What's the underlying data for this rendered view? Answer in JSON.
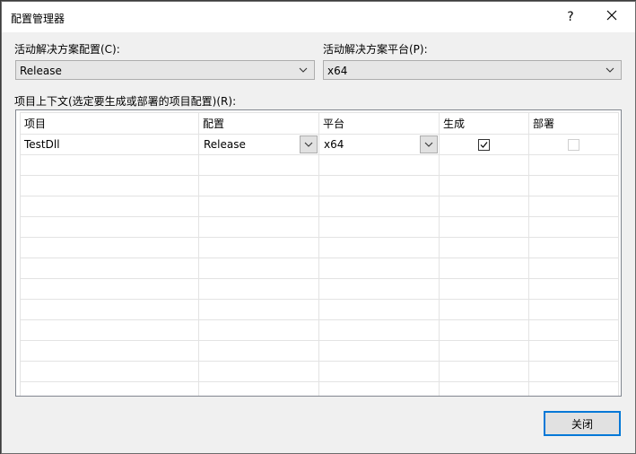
{
  "window": {
    "title": "配置管理器",
    "help_label": "?",
    "close_label": "✕"
  },
  "solution": {
    "config_label": "活动解决方案配置(C):",
    "config_value": "Release",
    "platform_label": "活动解决方案平台(P):",
    "platform_value": "x64"
  },
  "contexts": {
    "label": "项目上下文(选定要生成或部署的项目配置)(R):",
    "columns": {
      "project": "项目",
      "config": "配置",
      "platform": "平台",
      "build": "生成",
      "deploy": "部署"
    },
    "rows": [
      {
        "project": "TestDll",
        "config": "Release",
        "platform": "x64",
        "build_checked": true,
        "deploy_checked": false,
        "deploy_enabled": false
      }
    ]
  },
  "footer": {
    "close_button": "关闭"
  }
}
